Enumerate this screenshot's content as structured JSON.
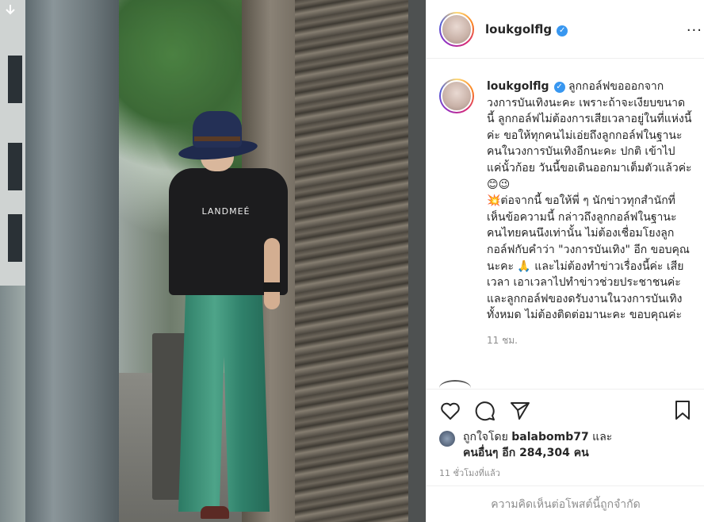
{
  "post": {
    "username": "loukgolflg",
    "verified_icon": "verified-badge-icon",
    "shirt_print": "LANDMEÉ",
    "caption": "ลูกกอล์ฟขอออกจากวงการบันเทิงนะคะ เพราะถ้าจะเงียบขนาดนี้ ลูกกอล์ฟไม่ต้องการเสียเวลาอยู่ในที่แห่งนี้ค่ะ ขอให้ทุกคนไม่เอ่ยถึงลูกกอล์ฟในฐานะคนในวงการบันเทิงอีกนะคะ ปกติ เข้าไปแค่นั้วก้อย วันนี้ขอเดินออกมาเต็มตัวแล้วค่ะ 😊😉\n💥ต่อจากนี้ ขอให้พี่ ๆ นักข่าวทุกสำนักที่เห็นข้อความนี้ กล่าวถึงลูกกอล์ฟในฐานะ คนไทยคนนึงเท่านั้น ไม่ต้องเชื่อมโยงลูกกอล์ฟกับคำว่า \"วงการบันเทิง\" อีก ขอบคุณนะคะ 🙏 และไม่ต้องทำข่าวเรื่องนี้ค่ะ เสียเวลา เอาเวลาไปทำข่าวช่วยประชาชนค่ะ และลูกกอล์ฟของดรับงานในวงการบันเทิงทั้งหมด ไม่ต้องติดต่อมานะคะ ขอบคุณค่ะ",
    "caption_time": "11 ชม.",
    "liked_by_prefix": "ถูกใจโดย",
    "liked_by_user": "balabomb77",
    "liked_by_and": "และ",
    "others_label": "คนอื่นๆ อีก 284,304 คน",
    "posted_ago": "11 ชั่วโมงที่แล้ว",
    "comments_limited": "ความคิดเห็นต่อโพสต์นี้ถูกจำกัด"
  },
  "icons": {
    "download": "download-arrow-icon",
    "like": "heart-icon",
    "comment": "comment-bubble-icon",
    "share": "paper-plane-icon",
    "save": "bookmark-icon",
    "more": "more-options-icon"
  },
  "colors": {
    "verified": "#3897f0",
    "text": "#262626",
    "muted": "#8e8e8e",
    "divider": "#efefef"
  }
}
